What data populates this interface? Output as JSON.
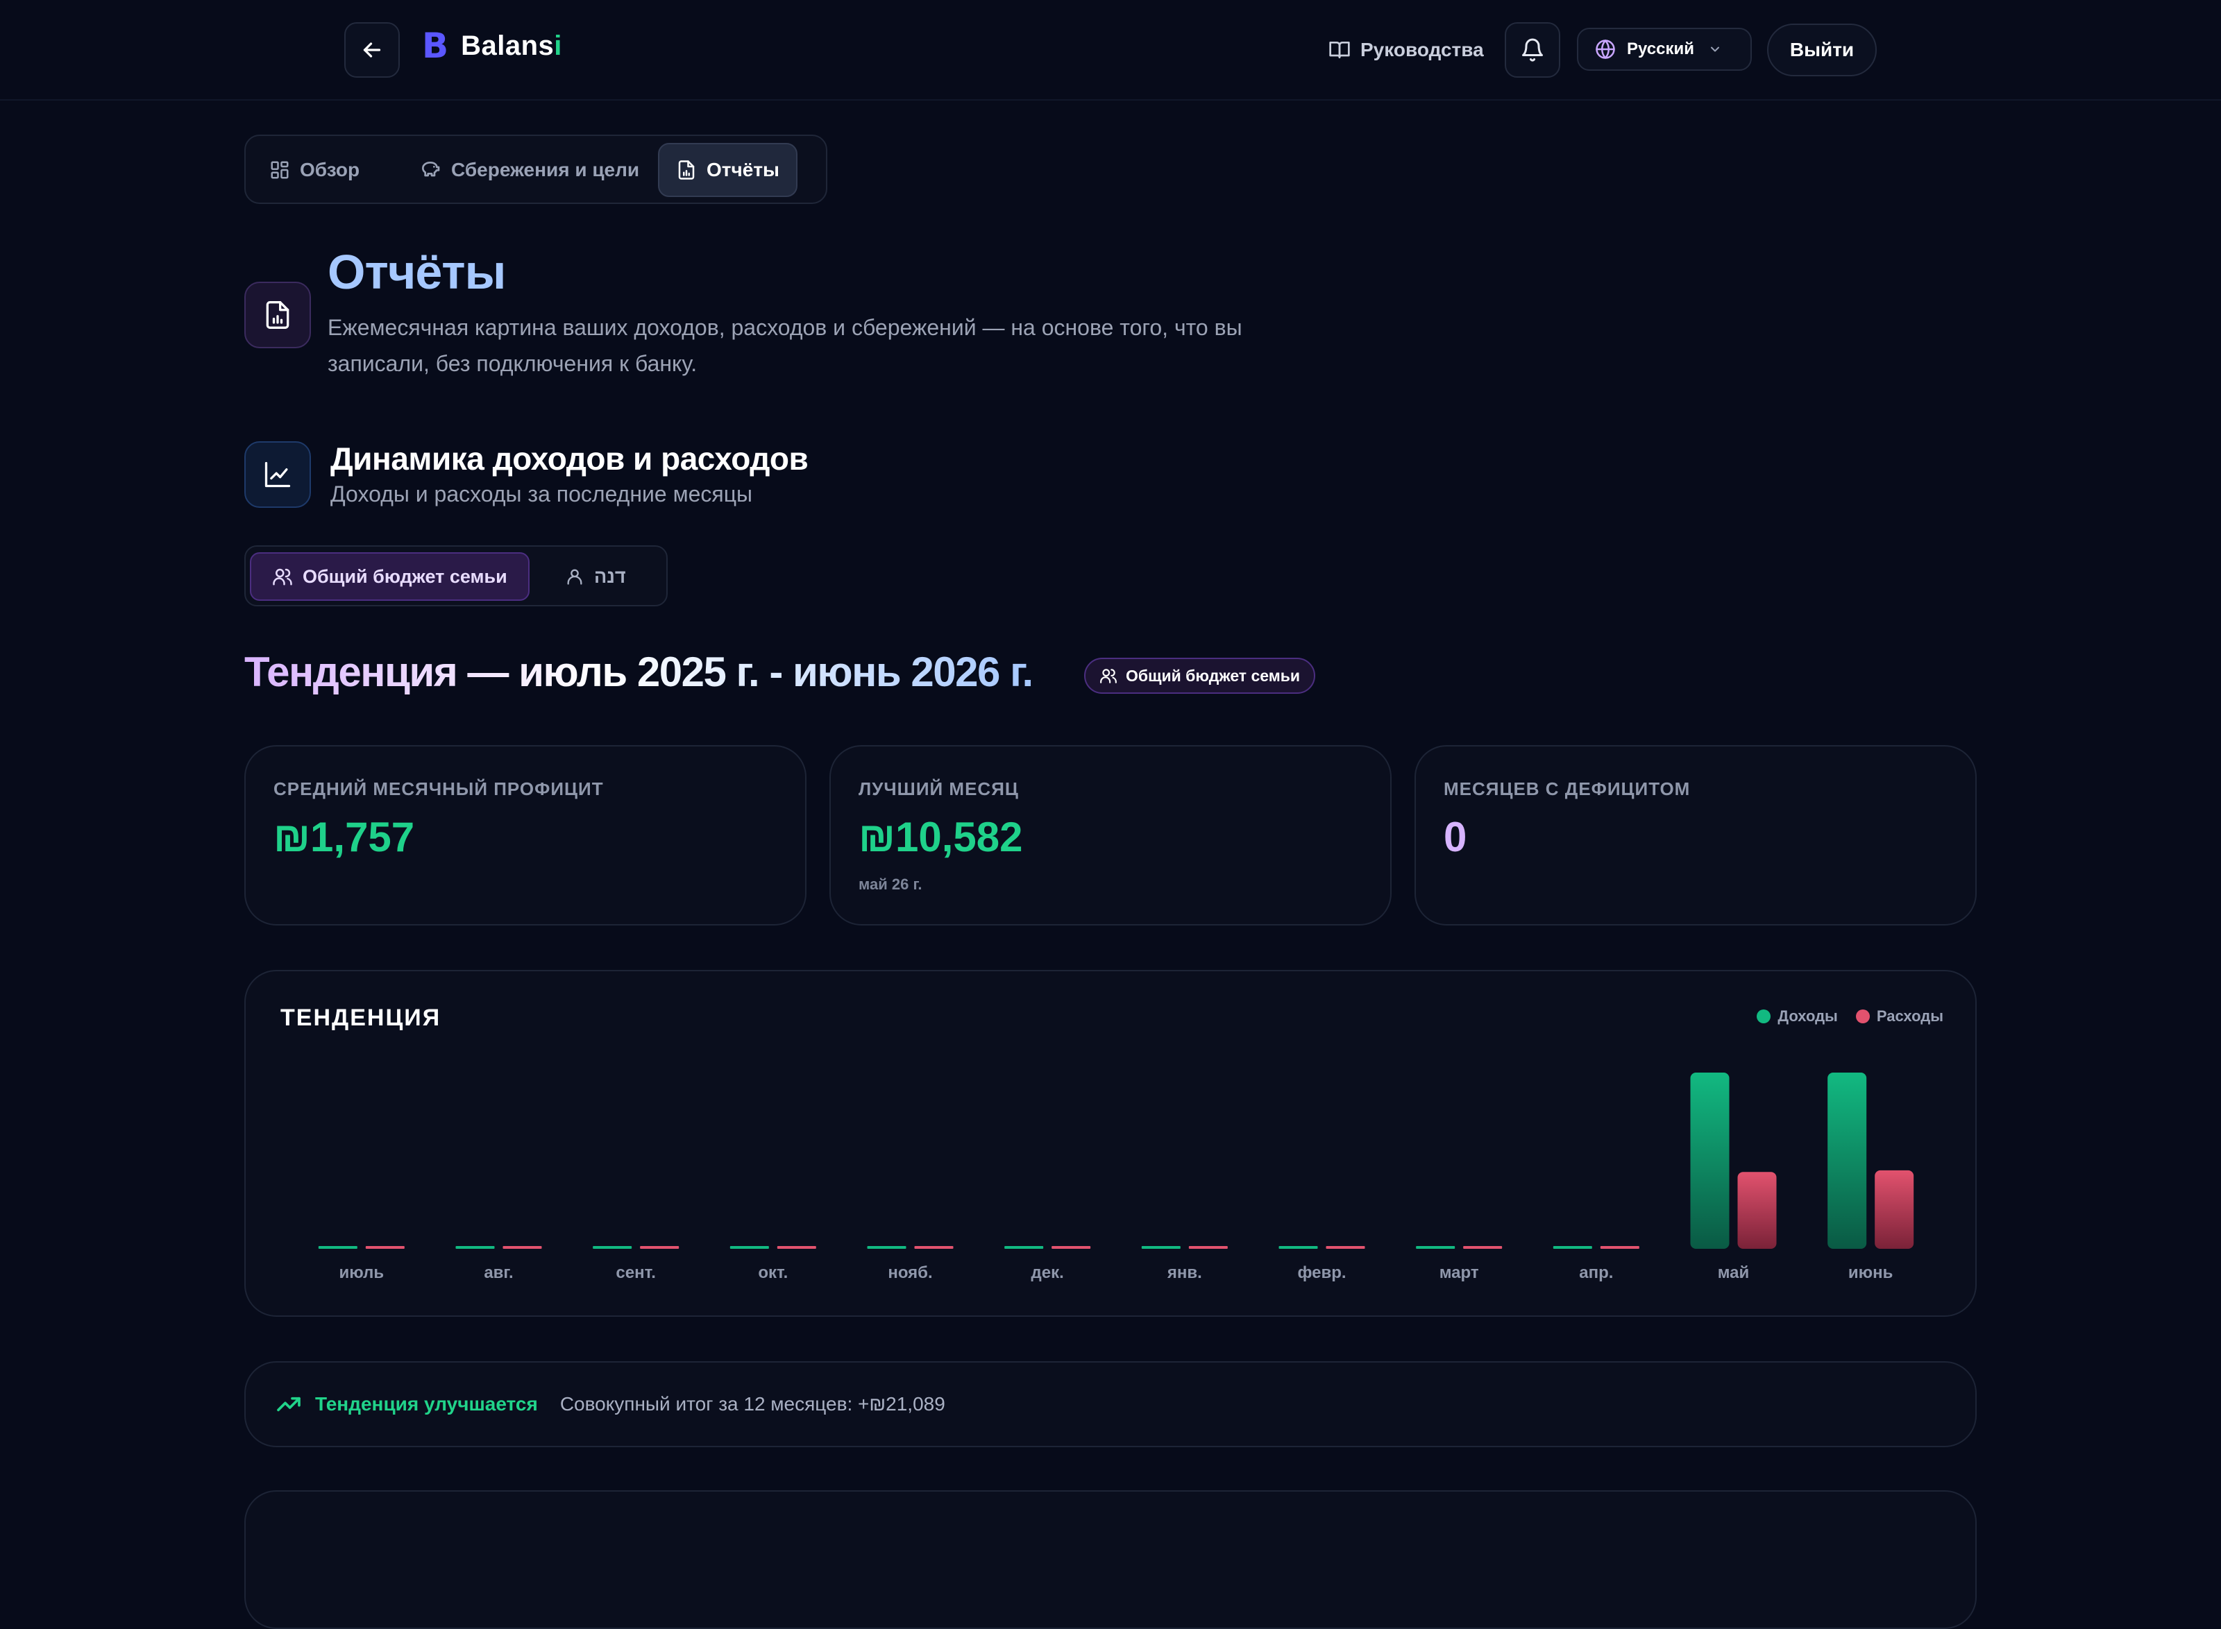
{
  "header": {
    "logo_mark": "B",
    "logo_name": "Balans",
    "logo_name_accent": "i",
    "guides_label": "Руководства",
    "language": "Русский",
    "logout_label": "Выйти"
  },
  "nav": {
    "tabs": [
      {
        "label": "Обзор",
        "icon": "grid-icon",
        "active": false
      },
      {
        "label": "Сбережения и цели",
        "icon": "piggy-bank-icon",
        "active": false
      },
      {
        "label": "Отчёты",
        "icon": "report-file-icon",
        "active": true
      }
    ]
  },
  "page": {
    "title": "Отчёты",
    "description": "Ежемесячная картина ваших доходов, расходов и сбережений — на основе того, что вы записали, без подключения к банку."
  },
  "section": {
    "title": "Динамика доходов и расходов",
    "subtitle": "Доходы и расходы за последние месяцы",
    "scope_tabs": [
      {
        "label": "Общий бюджет семьи",
        "icon": "users-icon",
        "active": true
      },
      {
        "label": "דנה",
        "icon": "user-icon",
        "active": false
      }
    ]
  },
  "trend": {
    "heading": "Тенденция — июль 2025 г. - июнь 2026 г.",
    "badge": "Общий бюджет семьи"
  },
  "stats": [
    {
      "label": "СРЕДНИЙ МЕСЯЧНЫЙ ПРОФИЦИТ",
      "value": "₪1,757",
      "sub": ""
    },
    {
      "label": "ЛУЧШИЙ МЕСЯЦ",
      "value": "₪10,582",
      "sub": "май 26 г."
    },
    {
      "label": "МЕСЯЦЕВ С ДЕФИЦИТОМ",
      "value": "0",
      "sub": ""
    }
  ],
  "chart_data": {
    "type": "bar",
    "title": "ТЕНДЕНЦИЯ",
    "categories": [
      "июль",
      "авг.",
      "сент.",
      "окт.",
      "нояб.",
      "дек.",
      "янв.",
      "февр.",
      "март",
      "апр.",
      "май",
      "июнь"
    ],
    "series": [
      {
        "name": "Доходы",
        "color": "#12b981",
        "values": [
          0,
          0,
          0,
          0,
          0,
          0,
          0,
          0,
          0,
          0,
          17650,
          17650
        ]
      },
      {
        "name": "Расходы",
        "color": "#e2526e",
        "values": [
          0,
          0,
          0,
          0,
          0,
          0,
          0,
          0,
          0,
          0,
          7700,
          7860
        ]
      }
    ],
    "ylim": [
      0,
      17650
    ],
    "grid": false,
    "legend": "top-right"
  },
  "insight": {
    "label": "Тенденция улучшается",
    "text": "Совокупный итог за 12 месяцев: +₪21,089"
  },
  "colors": {
    "background": "#070b1a",
    "income": "#12b981",
    "expense": "#e2526e",
    "accent_purple": "#d7b4ff",
    "accent_blue": "#a6c8ff"
  }
}
